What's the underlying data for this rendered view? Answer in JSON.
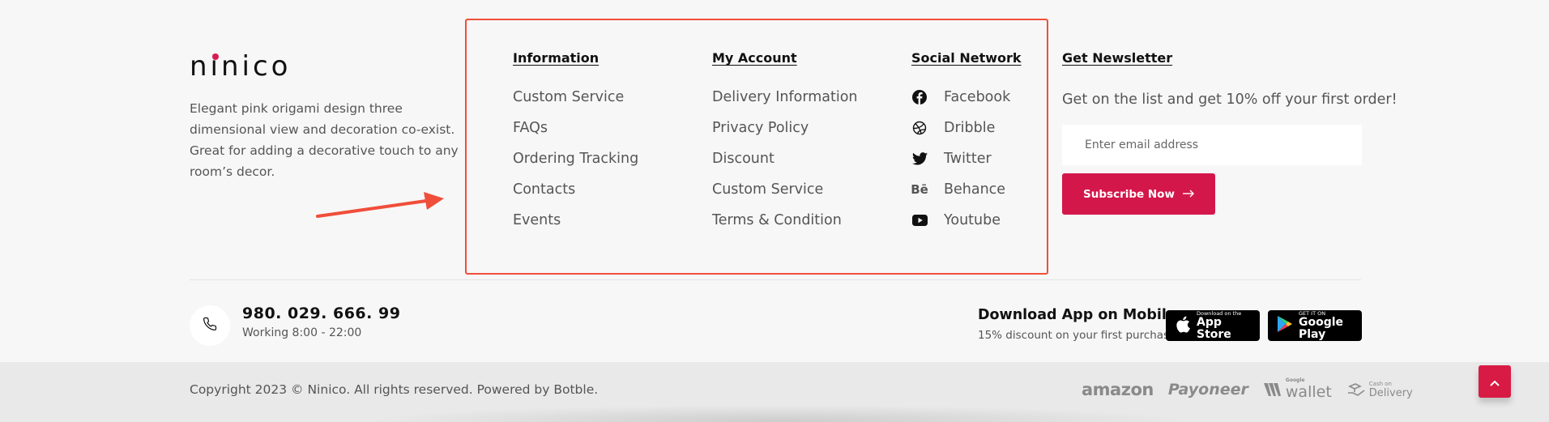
{
  "brand": {
    "logo_text": "ninico",
    "accent": "#d81b52"
  },
  "about": {
    "text": "Elegant pink origami design three dimensional view and decoration co-exist. Great for adding a decorative touch to any room’s decor."
  },
  "columns": {
    "information": {
      "title": "Information",
      "items": [
        "Custom Service",
        "FAQs",
        "Ordering Tracking",
        "Contacts",
        "Events"
      ]
    },
    "my_account": {
      "title": "My Account",
      "items": [
        "Delivery Information",
        "Privacy Policy",
        "Discount",
        "Custom Service",
        "Terms & Condition"
      ]
    },
    "social": {
      "title": "Social Network",
      "items": [
        {
          "label": "Facebook",
          "icon": "facebook-icon"
        },
        {
          "label": "Dribble",
          "icon": "dribbble-icon"
        },
        {
          "label": "Twitter",
          "icon": "twitter-icon"
        },
        {
          "label": "Behance",
          "icon": "behance-icon"
        },
        {
          "label": "Youtube",
          "icon": "youtube-icon"
        }
      ]
    }
  },
  "newsletter": {
    "title": "Get Newsletter",
    "text": "Get on the list and get 10% off your first order!",
    "email_placeholder": "Enter email address",
    "button_label": "Subscribe Now",
    "button_icon": "arrow-right-icon"
  },
  "contact": {
    "phone": "980. 029. 666. 99",
    "hours": "Working 8:00 - 22:00",
    "icon": "phone-icon"
  },
  "app": {
    "title": "Download App on Mobile",
    "subtitle": "15% discount on your first purchase",
    "appstore": {
      "small": "Download on the",
      "big": "App Store"
    },
    "playstore": {
      "small": "GET IT ON",
      "big": "Google Play"
    }
  },
  "footer": {
    "copyright": "Copyright 2023 © Ninico. All rights reserved. Powered by Botble.",
    "payments": {
      "amazon": "amazon",
      "payoneer": "Payoneer",
      "wallet_small": "Google",
      "wallet": "wallet",
      "cod_small": "Cash on",
      "cod_big": "Delivery"
    }
  },
  "colors": {
    "highlight_border": "#f04e3a",
    "subscribe_bg": "#d4174b",
    "to_top_bg": "#d81b44"
  }
}
